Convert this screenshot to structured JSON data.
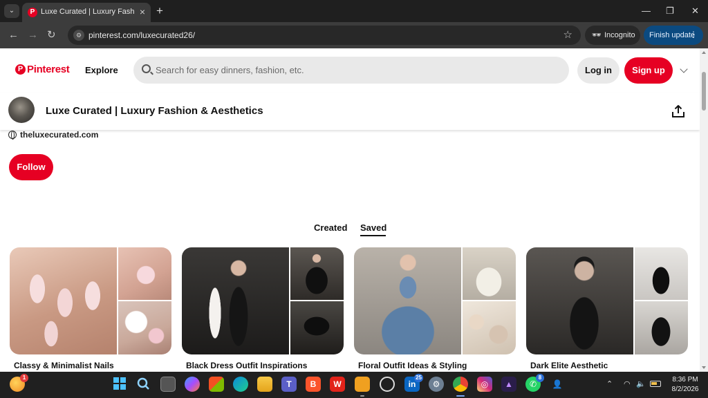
{
  "browser": {
    "tab_title": "Luxe Curated | Luxury Fashion & Aesthetics",
    "url": "pinterest.com/luxecurated26/",
    "incognito_label": "Incognito",
    "finish_update_label": "Finish update",
    "new_tab": "+",
    "close_tab": "×"
  },
  "header": {
    "logo_text": "Pinterest",
    "explore_label": "Explore",
    "search_placeholder": "Search for easy dinners, fashion, etc.",
    "login_label": "Log in",
    "signup_label": "Sign up"
  },
  "profile": {
    "name": "Luxe Curated | Luxury Fashion & Aesthetics",
    "website": "theluxecurated.com",
    "follow_label": "Follow"
  },
  "profile_tabs": {
    "created": "Created",
    "saved": "Saved",
    "active": "Saved"
  },
  "boards": [
    {
      "title": "Classy & Minimalist Nails"
    },
    {
      "title": "Black Dress Outfit Inspirations"
    },
    {
      "title": "Floral Outfit Ideas & Styling"
    },
    {
      "title": "Dark Elite Aesthetic"
    }
  ],
  "taskbar": {
    "linkedin_badge": "25",
    "whatsapp_badge": "8",
    "weather_badge": "1",
    "time": "8:36 PM",
    "date": "8/2/2026"
  },
  "colors": {
    "pinterest_red": "#e60023",
    "chrome_dark": "#1f1f1f",
    "update_blue": "#0b4a80"
  }
}
